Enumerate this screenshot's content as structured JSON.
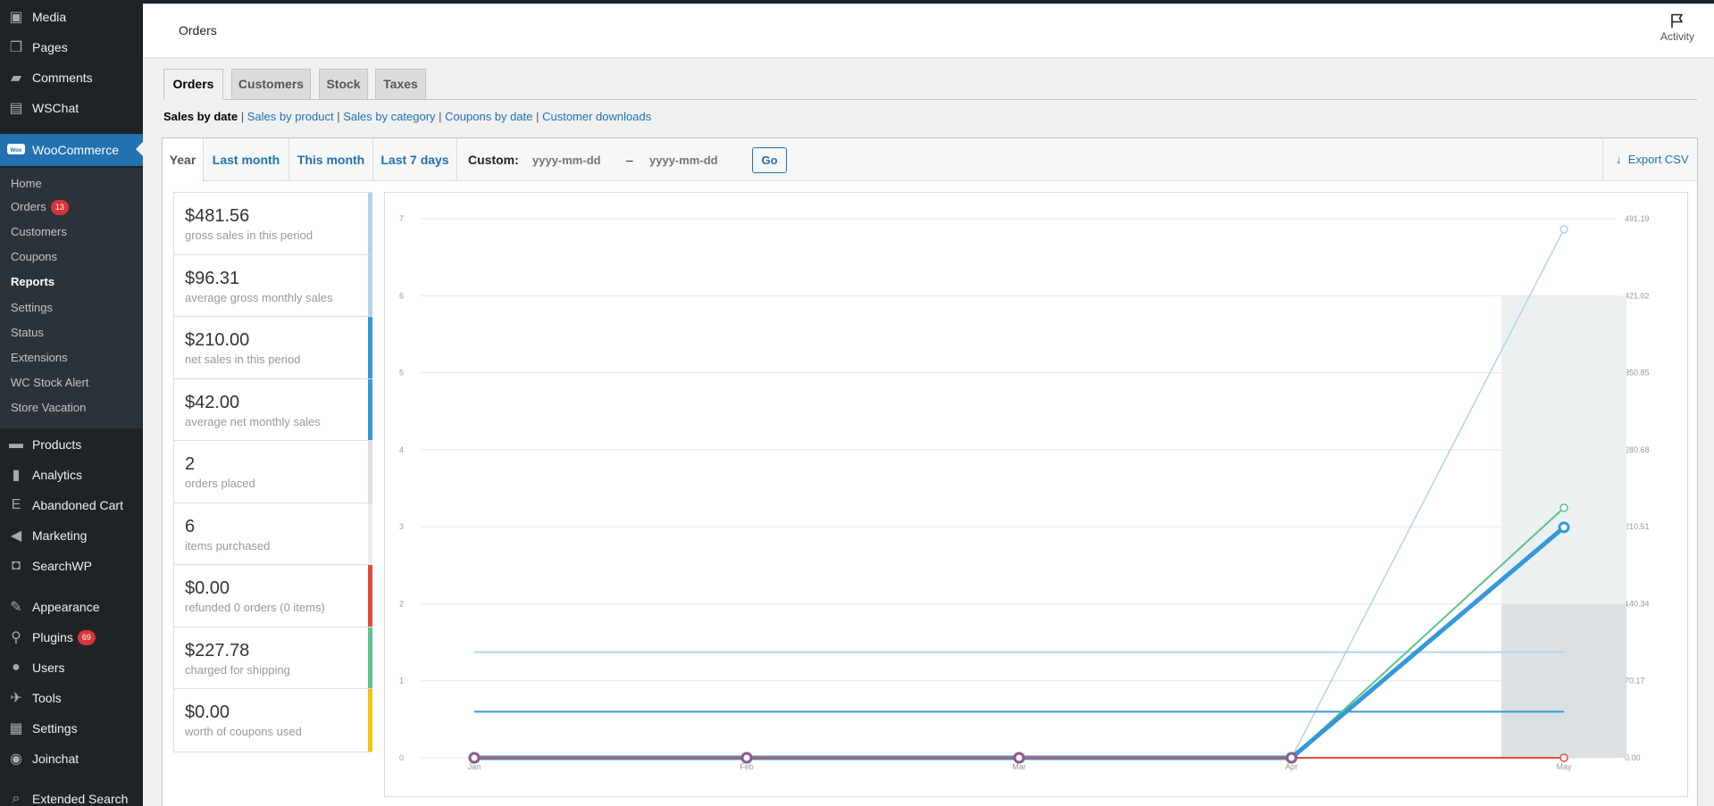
{
  "sidebar": {
    "top_items": [
      {
        "label": "Media",
        "icon": "media-icon"
      },
      {
        "label": "Pages",
        "icon": "pages-icon"
      },
      {
        "label": "Comments",
        "icon": "comments-icon"
      },
      {
        "label": "WSChat",
        "icon": "chat-icon"
      }
    ],
    "woocommerce": {
      "label": "WooCommerce",
      "icon": "woocommerce-icon"
    },
    "submenu": [
      {
        "label": "Home"
      },
      {
        "label": "Orders",
        "badge": "13"
      },
      {
        "label": "Customers"
      },
      {
        "label": "Coupons"
      },
      {
        "label": "Reports"
      },
      {
        "label": "Settings"
      },
      {
        "label": "Status"
      },
      {
        "label": "Extensions"
      },
      {
        "label": "WC Stock Alert"
      },
      {
        "label": "Store Vacation"
      }
    ],
    "bottom_items": [
      {
        "label": "Products",
        "icon": "products-icon"
      },
      {
        "label": "Analytics",
        "icon": "analytics-icon"
      },
      {
        "label": "Abandoned Cart",
        "icon": "abandoned-cart-icon"
      },
      {
        "label": "Marketing",
        "icon": "megaphone-icon"
      },
      {
        "label": "SearchWP",
        "icon": "searchwp-icon"
      },
      {
        "label": "Appearance",
        "icon": "brush-icon"
      },
      {
        "label": "Plugins",
        "icon": "plugins-icon",
        "badge": "69"
      },
      {
        "label": "Users",
        "icon": "users-icon"
      },
      {
        "label": "Tools",
        "icon": "wrench-icon"
      },
      {
        "label": "Settings",
        "icon": "settings-icon"
      },
      {
        "label": "Joinchat",
        "icon": "whatsapp-icon"
      },
      {
        "label": "Extended Search",
        "icon": "search-icon"
      }
    ]
  },
  "header": {
    "title": "Orders",
    "activity_label": "Activity"
  },
  "tabs": [
    "Orders",
    "Customers",
    "Stock",
    "Taxes"
  ],
  "report_links": {
    "current": "Sales by date",
    "links": [
      "Sales by product",
      "Sales by category",
      "Coupons by date",
      "Customer downloads"
    ]
  },
  "ranges": [
    "Year",
    "Last month",
    "This month",
    "Last 7 days"
  ],
  "custom": {
    "label": "Custom:",
    "start_placeholder": "yyyy-mm-dd",
    "end_placeholder": "yyyy-mm-dd",
    "dash": "–",
    "go_label": "Go"
  },
  "export_label": "Export CSV",
  "legend": [
    {
      "amount": "$481.56",
      "desc": "gross sales in this period",
      "color": "#b1d4ea"
    },
    {
      "amount": "$96.31",
      "desc": "average gross monthly sales",
      "color": "#b1d4ea"
    },
    {
      "amount": "$210.00",
      "desc": "net sales in this period",
      "color": "#3498db"
    },
    {
      "amount": "$42.00",
      "desc": "average net monthly sales",
      "color": "#3498db"
    },
    {
      "amount": "2",
      "desc": "orders placed",
      "color": "#dbe1e3"
    },
    {
      "amount": "6",
      "desc": "items purchased",
      "color": "#ecf0f1"
    },
    {
      "amount": "$0.00",
      "desc": "refunded 0 orders (0 items)",
      "color": "#e74c3c"
    },
    {
      "amount": "$227.78",
      "desc": "charged for shipping",
      "color": "#5cc488"
    },
    {
      "amount": "$0.00",
      "desc": "worth of coupons used",
      "color": "#f1c40f"
    }
  ],
  "chart_data": {
    "type": "line",
    "categories": [
      "Jan",
      "Feb",
      "Mar",
      "Apr",
      "May"
    ],
    "left_ticks": [
      "0",
      "1",
      "2",
      "3",
      "4",
      "5",
      "6",
      "7"
    ],
    "right_ticks": [
      "0.00",
      "70.17",
      "140.34",
      "210.51",
      "280.68",
      "350.85",
      "421.02",
      "491.19"
    ],
    "ylim_left": [
      0,
      7
    ],
    "ylim_right": [
      0,
      491.19
    ],
    "bars": [
      {
        "name": "orders placed",
        "color": "#dbe1e3",
        "axis": "left",
        "values": [
          0,
          0,
          0,
          0,
          2
        ]
      },
      {
        "name": "items purchased",
        "color": "#ecf0f1",
        "axis": "left",
        "values": [
          0,
          0,
          0,
          0,
          6
        ]
      }
    ],
    "series": [
      {
        "name": "gross sales",
        "color": "#b1d4ea",
        "width": 1.5,
        "points": true,
        "values": [
          0,
          0,
          0,
          0,
          481.56
        ]
      },
      {
        "name": "average gross monthly sales",
        "color": "#b1d4ea",
        "width": 2,
        "points": false,
        "values": [
          96.31,
          96.31,
          96.31,
          96.31,
          96.31
        ]
      },
      {
        "name": "average net monthly sales",
        "color": "#3498db",
        "width": 2,
        "points": false,
        "values": [
          42,
          42,
          42,
          42,
          42
        ]
      },
      {
        "name": "shipping",
        "color": "#5cc488",
        "width": 2,
        "points": true,
        "values": [
          0,
          0,
          0,
          0,
          227.78
        ]
      },
      {
        "name": "net sales",
        "color": "#3498db",
        "width": 5,
        "points": true,
        "values": [
          0,
          0,
          0,
          0,
          210
        ]
      },
      {
        "name": "refunds",
        "color": "#e74c3c",
        "width": 2,
        "points": true,
        "values": [
          0,
          0,
          0,
          0,
          0
        ]
      }
    ]
  }
}
